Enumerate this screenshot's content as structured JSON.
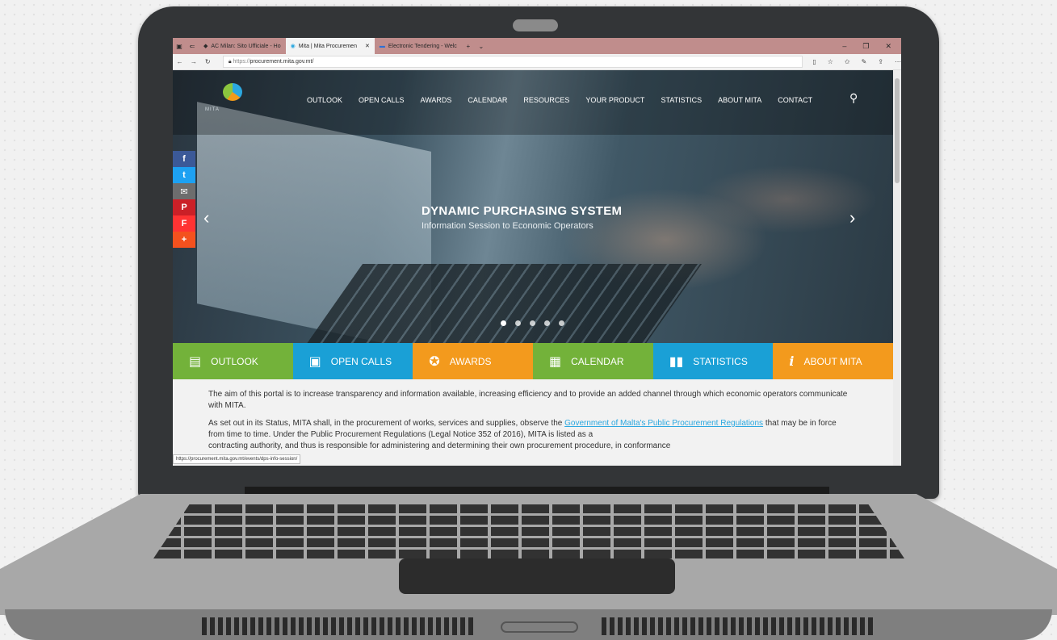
{
  "browser": {
    "tabs": [
      {
        "label": "AC Milan: Sito Ufficiale - Ho"
      },
      {
        "label": "Mita | Mita Procuremen"
      },
      {
        "label": "Electronic Tendering - Welc"
      }
    ],
    "url_prefix": "https://",
    "url_host": "procurement.mita.gov.mt/",
    "status_url": "https://procurement.mita.gov.mt/events/dps-info-session/"
  },
  "site": {
    "logo_text": "MITA",
    "nav": [
      "OUTLOOK",
      "OPEN CALLS",
      "AWARDS",
      "CALENDAR",
      "RESOURCES",
      "YOUR PRODUCT",
      "STATISTICS",
      "ABOUT MITA",
      "CONTACT"
    ],
    "hero": {
      "title": "DYNAMIC PURCHASING SYSTEM",
      "subtitle": "Information Session to Economic Operators"
    },
    "social": [
      {
        "glyph": "f",
        "color": "#3b5998"
      },
      {
        "glyph": "t",
        "color": "#1da1f2"
      },
      {
        "glyph": "✉",
        "color": "#6d6d6d"
      },
      {
        "glyph": "P",
        "color": "#cb2027"
      },
      {
        "glyph": "F",
        "color": "#f33"
      },
      {
        "glyph": "+",
        "color": "#f4511e"
      }
    ],
    "tiles": [
      {
        "label": "OUTLOOK",
        "glyph": "▤",
        "color": "#73b23a"
      },
      {
        "label": "OPEN CALLS",
        "glyph": "▣",
        "color": "#1aa0d6"
      },
      {
        "label": "AWARDS",
        "glyph": "✪",
        "color": "#f39a1d"
      },
      {
        "label": "CALENDAR",
        "glyph": "▦",
        "color": "#73b23a"
      },
      {
        "label": "STATISTICS",
        "glyph": "▮▮",
        "color": "#1aa0d6"
      },
      {
        "label": "ABOUT MITA",
        "glyph": "i",
        "color": "#f39a1d"
      }
    ],
    "content": {
      "p1": "The aim of this portal is to increase transparency and information available, increasing efficiency and to provide an added channel through which economic operators communicate with MITA.",
      "p2_a": "As set out in its Status, MITA shall, in the procurement of works, services and supplies, observe the ",
      "p2_link": "Government of Malta's Public Procurement Regulations",
      "p2_b": " that may be in force from time to time. Under the Public Procurement Regulations (Legal Notice 352 of 2016), MITA is listed as a",
      "p3": "contracting authority, and thus is responsible for administering and determining their own procurement procedure, in conformance"
    }
  }
}
